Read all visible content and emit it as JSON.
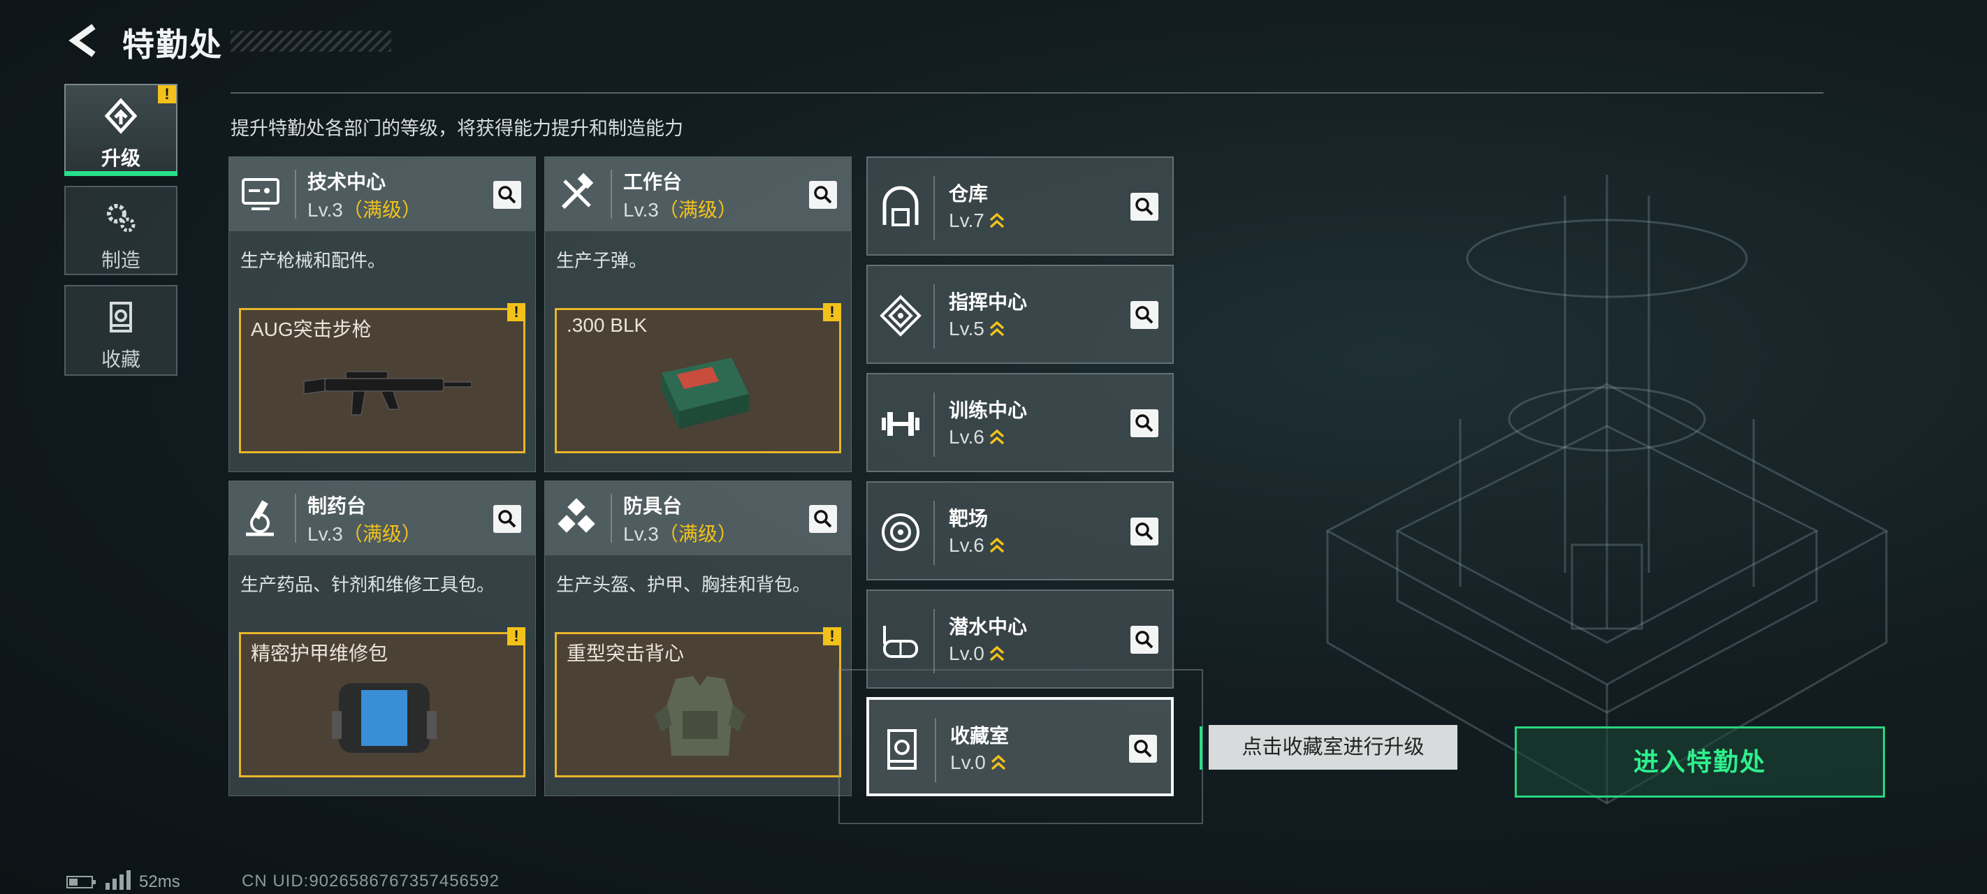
{
  "header": {
    "title": "特勤处"
  },
  "nav": [
    {
      "label": "升级",
      "icon": "upgrade-icon",
      "active": true,
      "warning": "!"
    },
    {
      "label": "制造",
      "icon": "gears-icon",
      "active": false
    },
    {
      "label": "收藏",
      "icon": "collection-icon",
      "active": false
    }
  ],
  "subtitle": "提升特勤处各部门的等级，将获得能力提升和制造能力",
  "cards": [
    {
      "name": "技术中心",
      "level": "Lv.3",
      "max": "（满级）",
      "desc": "生产枪械和配件。",
      "product": "AUG突击步枪",
      "warning": "!"
    },
    {
      "name": "工作台",
      "level": "Lv.3",
      "max": "（满级）",
      "desc": "生产子弹。",
      "product": ".300 BLK",
      "warning": "!"
    },
    {
      "name": "制药台",
      "level": "Lv.3",
      "max": "（满级）",
      "desc": "生产药品、针剂和维修工具包。",
      "product": "精密护甲维修包",
      "warning": "!"
    },
    {
      "name": "防具台",
      "level": "Lv.3",
      "max": "（满级）",
      "desc": "生产头盔、护甲、胸挂和背包。",
      "product": "重型突击背心",
      "warning": "!"
    }
  ],
  "facilities": [
    {
      "name": "仓库",
      "level": "Lv.7"
    },
    {
      "name": "指挥中心",
      "level": "Lv.5"
    },
    {
      "name": "训练中心",
      "level": "Lv.6"
    },
    {
      "name": "靶场",
      "level": "Lv.6"
    },
    {
      "name": "潜水中心",
      "level": "Lv.0"
    },
    {
      "name": "收藏室",
      "level": "Lv.0"
    }
  ],
  "tooltip": "点击收藏室进行升级",
  "enter_button": "进入特勤处",
  "footer": {
    "ping": "52ms",
    "uid": "CN UID:9026586767357456592"
  },
  "colors": {
    "accent": "#27e08a",
    "warning": "#f2c21b",
    "product_border": "#e8b62a"
  }
}
